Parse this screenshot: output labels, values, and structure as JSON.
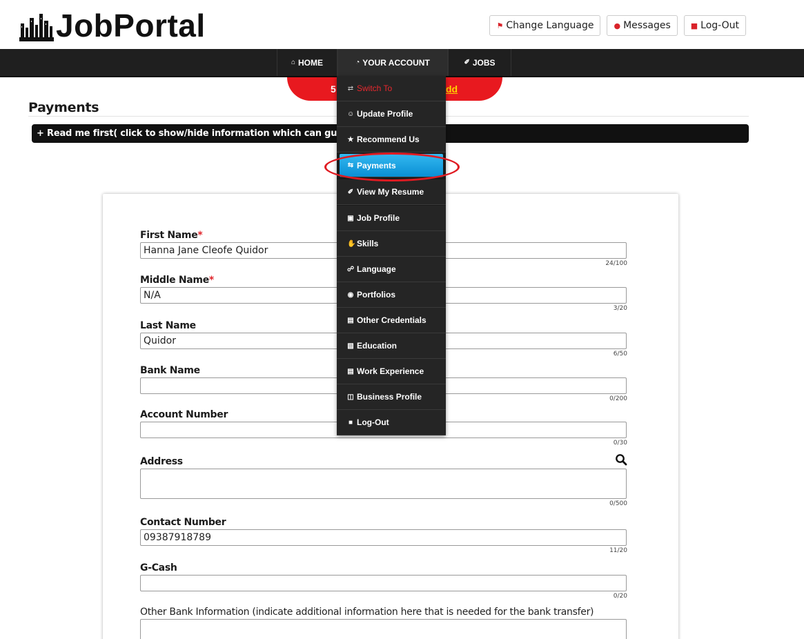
{
  "header": {
    "logo_text": "JobPortal",
    "buttons": [
      {
        "label": "Change Language",
        "icon": "flag-icon"
      },
      {
        "label": "Messages",
        "icon": "message-icon"
      },
      {
        "label": "Log-Out",
        "icon": "lock-icon"
      }
    ]
  },
  "nav": {
    "home": "HOME",
    "account": "YOUR ACCOUNT",
    "jobs": "JOBS"
  },
  "banner": {
    "left_text": "5",
    "right_text": "dd"
  },
  "dropdown": {
    "items": [
      {
        "label": "Switch To",
        "icon": "shuffle-icon"
      },
      {
        "label": "Update Profile",
        "icon": "user-icon"
      },
      {
        "label": "Recommend Us",
        "icon": "star-icon"
      },
      {
        "label": "Payments",
        "icon": "exchange-icon"
      },
      {
        "label": "View My Resume",
        "icon": "pencil-icon"
      },
      {
        "label": "Job Profile",
        "icon": "id-card-icon"
      },
      {
        "label": "Skills",
        "icon": "hand-icon"
      },
      {
        "label": "Language",
        "icon": "language-icon"
      },
      {
        "label": "Portfolios",
        "icon": "eye-icon"
      },
      {
        "label": "Other Credentials",
        "icon": "book-icon"
      },
      {
        "label": "Education",
        "icon": "education-icon"
      },
      {
        "label": "Work Experience",
        "icon": "list-icon"
      },
      {
        "label": "Business Profile",
        "icon": "clipboard-icon"
      },
      {
        "label": "Log-Out",
        "icon": "lock-icon"
      }
    ]
  },
  "page": {
    "title": "Payments",
    "info_bar": "+ Read me first( click to show/hide information which can guid"
  },
  "form": {
    "first_name": {
      "label": "First Name",
      "required": "*",
      "value": "Hanna Jane Cleofe Quidor",
      "counter": "24/100"
    },
    "middle_name": {
      "label": "Middle Name",
      "required": "*",
      "value": "N/A",
      "counter": "3/20"
    },
    "last_name": {
      "label": "Last Name",
      "value": "Quidor",
      "counter": "6/50"
    },
    "bank_name": {
      "label": "Bank Name",
      "value": "",
      "counter": "0/200"
    },
    "account_number": {
      "label": "Account Number",
      "value": "",
      "counter": "0/30"
    },
    "address": {
      "label": "Address",
      "value": "",
      "counter": "0/500"
    },
    "contact_number": {
      "label": "Contact Number",
      "value": "09387918789",
      "counter": "11/20"
    },
    "gcash": {
      "label": "G-Cash",
      "value": "",
      "counter": "0/20"
    },
    "other_bank": {
      "label": "Other Bank Information (indicate additional information here that is needed for the bank transfer)",
      "value": ""
    }
  },
  "colors": {
    "accent_red": "#e8191f",
    "nav_bg": "#1f1f1f",
    "active_blue": "#1aa3e3"
  }
}
